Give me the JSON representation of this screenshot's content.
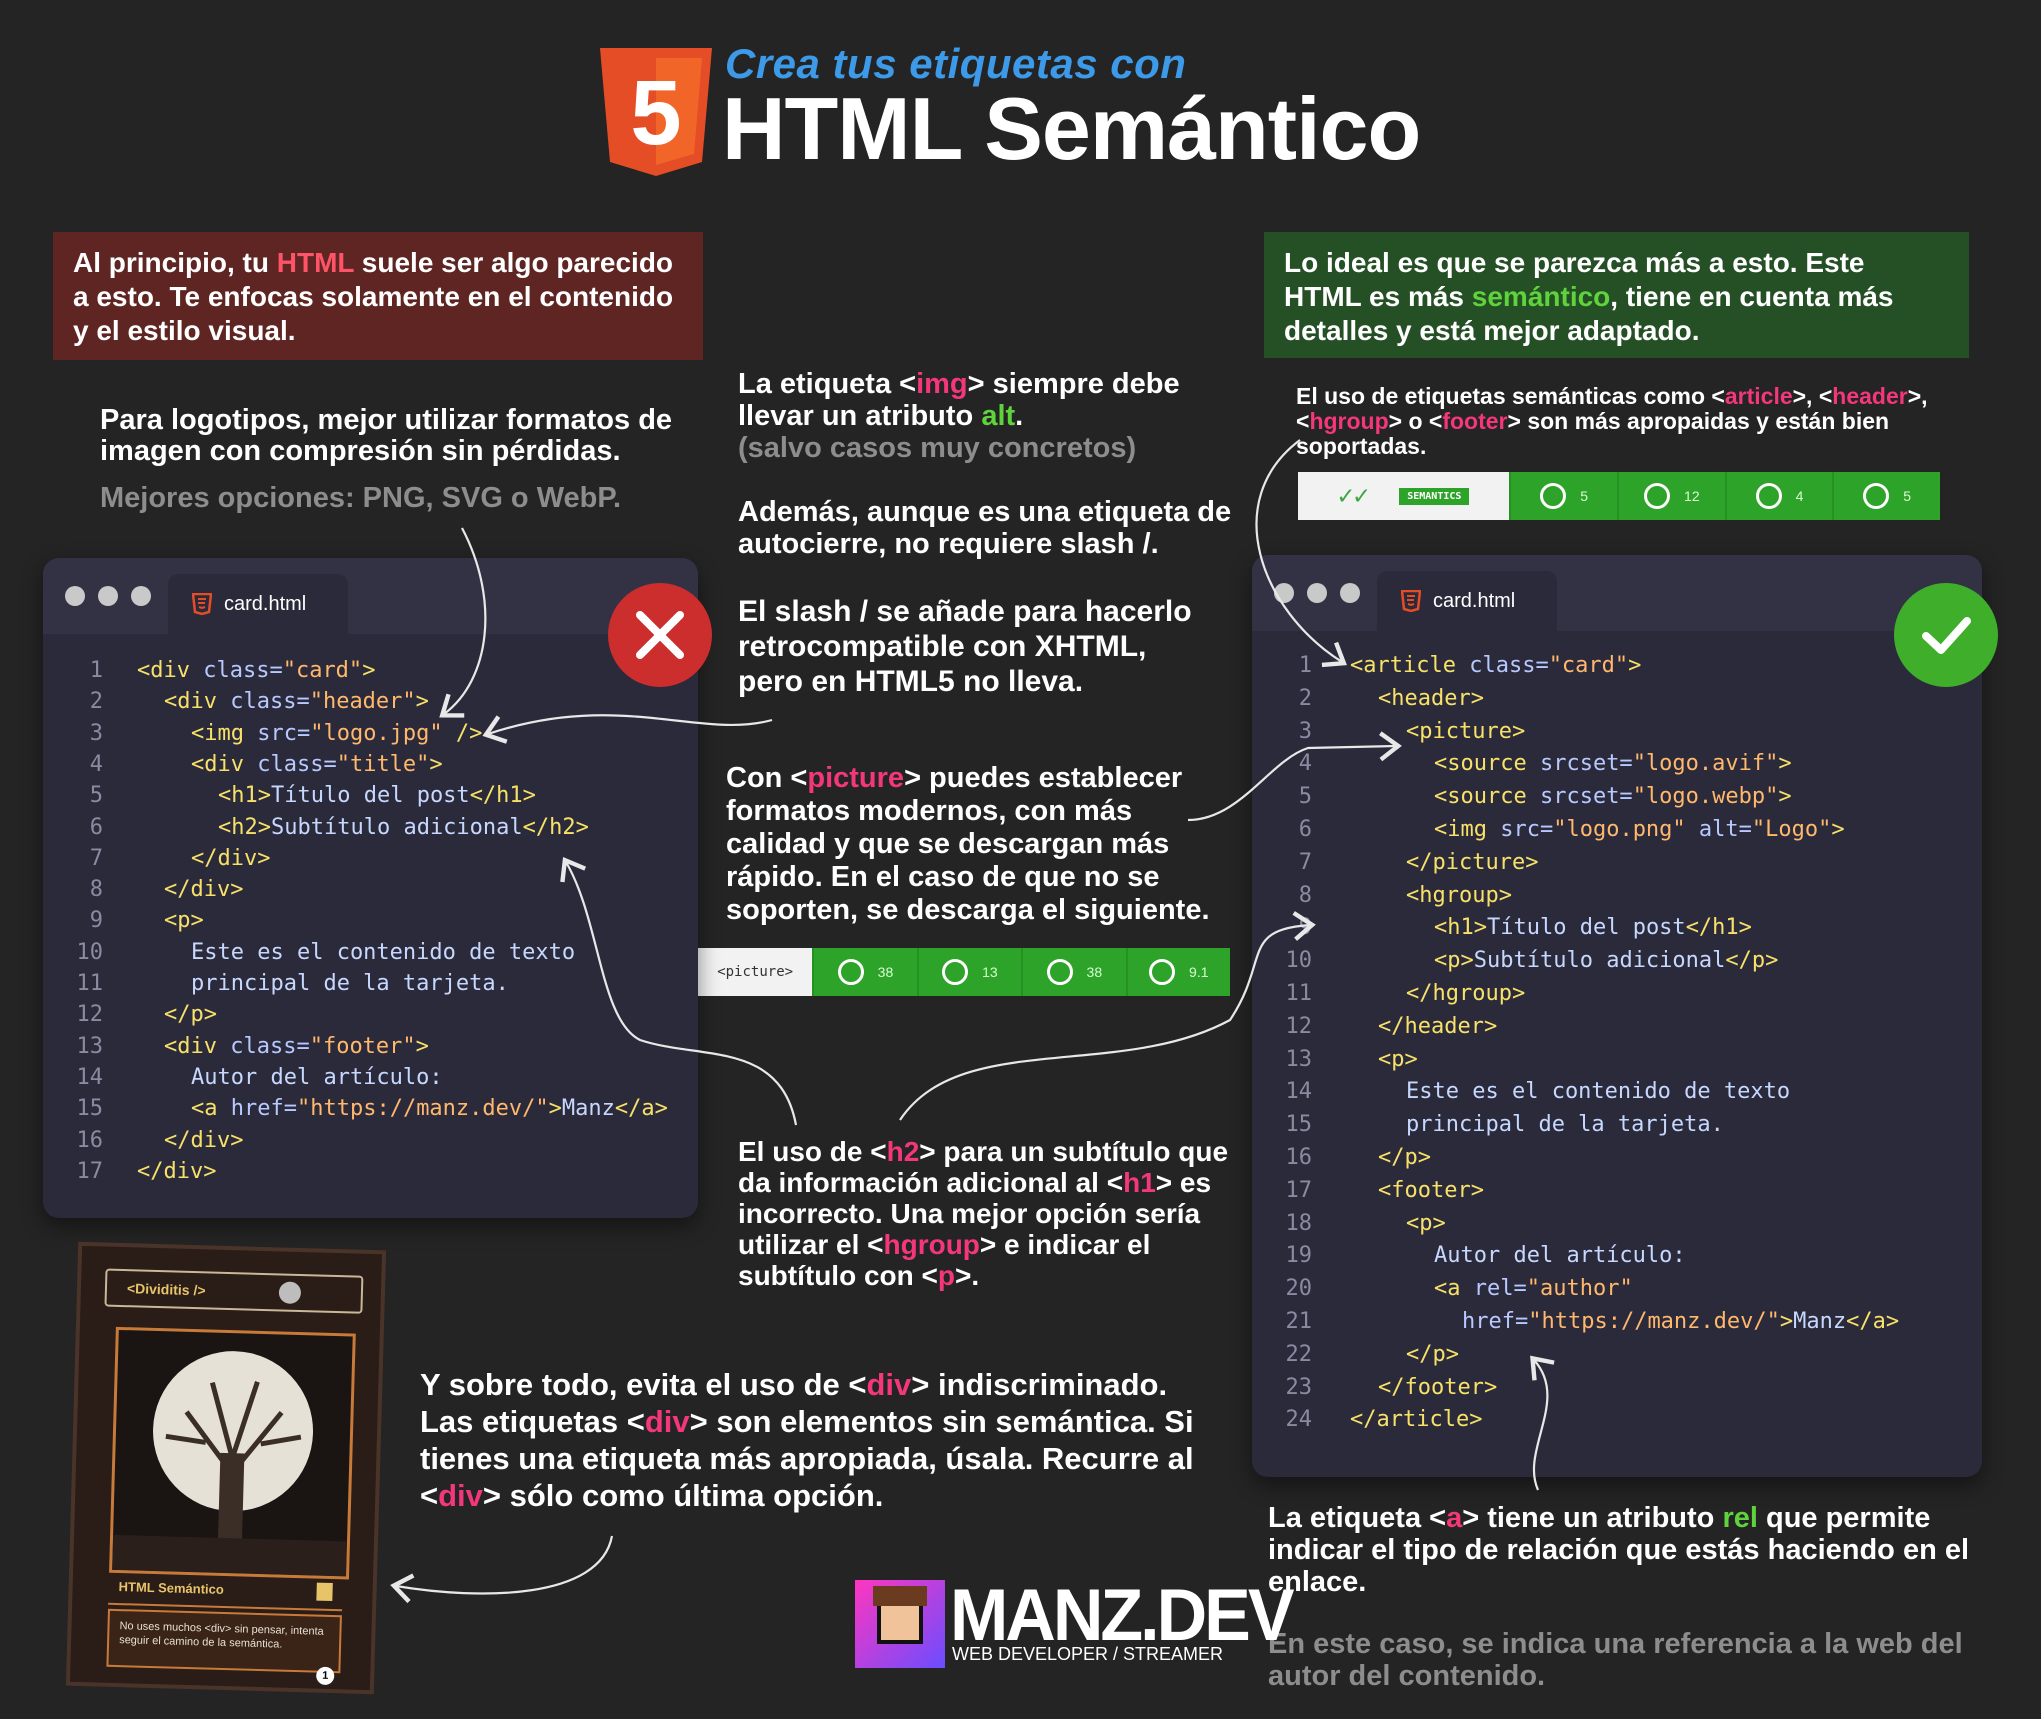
{
  "header": {
    "logo_number": "5",
    "kicker": "Crea tus etiquetas con",
    "title": "HTML Semántico"
  },
  "intro_bad": {
    "pre": "Al principio, tu ",
    "highlight": "HTML",
    "post": " suele ser algo parecido a esto. Te enfocas solamente en el contenido y el estilo visual."
  },
  "intro_good": {
    "pre": "Lo ideal es que se parezca más a esto. Este HTML es más ",
    "highlight": "semántico",
    "post": ", tiene en cuenta más detalles y está mejor adaptado."
  },
  "notes": {
    "logos_main": "Para logotipos, mejor utilizar formatos de imagen con compresión sin pérdidas.",
    "logos_sub": "Mejores opciones: PNG, SVG o WebP.",
    "img_1": "La etiqueta <",
    "img_tag": "img",
    "img_2": "> siempre debe llevar un atributo ",
    "img_attr": "alt",
    "img_3": ".",
    "img_sub": "(salvo casos muy concretos)",
    "slash_main": "Además, aunque es una etiqueta de autocierre, no requiere slash /.",
    "slash_sub": "El slash / se añade para hacerlo retrocompatible con XHTML, pero en HTML5 no lleva.",
    "picture_1": "Con <",
    "picture_tag": "picture",
    "picture_2": "> puedes establecer formatos modernos, con más calidad y que se descargan más rápido. En el caso de que no se soporten, se descarga el siguiente.",
    "h2_1": "El uso de <",
    "h2_tag": "h2",
    "h2_2": "> para un subtítulo que da información adicional al <",
    "h2_tag2": "h1",
    "h2_3": "> es incorrecto. Una mejor opción sería utilizar el <",
    "h2_tag3": "hgroup",
    "h2_4": "> e indicar el subtítulo con <",
    "h2_tag4": "p",
    "h2_5": ">.",
    "div_1": "Y sobre todo, evita el uso de <",
    "div_tag": "div",
    "div_2": "> indiscriminado. Las etiquetas <",
    "div_tag2": "div",
    "div_3": "> son elementos sin semántica. Si tienes una etiqueta más apropiada, úsala. Recurre al <",
    "div_tag3": "div",
    "div_4": "> sólo como última opción.",
    "sem_1": "El uso de etiquetas semánticas como <",
    "sem_t1": "article",
    "sem_2": ">, <",
    "sem_t2": "header",
    "sem_3": ">, <",
    "sem_t3": "hgroup",
    "sem_4": "> o <",
    "sem_t4": "footer",
    "sem_5": "> son más apropaidas y están bien soportadas.",
    "a_1": "La etiqueta <",
    "a_tag": "a",
    "a_2": "> tiene un atributo ",
    "a_attr": "rel",
    "a_3": " que permite indicar el tipo de relación que estás haciendo en el enlace.",
    "a_sub": "En este caso, se indica una referencia a la web del autor del contenido."
  },
  "bad_window": {
    "filename": "card.html",
    "line_numbers": [
      "1",
      "2",
      "3",
      "4",
      "5",
      "6",
      "7",
      "8",
      "9",
      "10",
      "11",
      "12",
      "13",
      "14",
      "15",
      "16",
      "17"
    ]
  },
  "good_window": {
    "filename": "card.html",
    "line_numbers": [
      "1",
      "2",
      "3",
      "4",
      "5",
      "6",
      "7",
      "8",
      "9",
      "10",
      "11",
      "12",
      "13",
      "14",
      "15",
      "16",
      "17",
      "18",
      "19",
      "20",
      "21",
      "22",
      "23",
      "24"
    ]
  },
  "code_tokens": {
    "div": "div",
    "class": "class",
    "card": "\"card\"",
    "header": "\"header\"",
    "img": "img",
    "src": "src",
    "logo_jpg": "\"logo.jpg\"",
    "slash_end": "/>",
    "title": "\"title\"",
    "h1": "h1",
    "h1_text": "Título del post",
    "h2": "h2",
    "h2_text": "Subtítulo adicional",
    "p": "p",
    "p_text1": "Este es el contenido de texto",
    "p_text2": "principal de la tarjeta.",
    "footer": "\"footer\"",
    "author_label": "Autor del artículo:",
    "a": "a",
    "href": "href",
    "url": "\"https://manz.dev/\"",
    "manz": "Manz",
    "article": "article",
    "header_tag": "header",
    "picture": "picture",
    "source": "source",
    "srcset": "srcset",
    "avif": "\"logo.avif\"",
    "webp": "\"logo.webp\"",
    "logo_png": "\"logo.png\"",
    "alt": "alt",
    "logo_alt": "\"Logo\"",
    "hgroup": "hgroup",
    "footer_tag": "footer",
    "rel": "rel",
    "author": "\"author\""
  },
  "compat_picture": {
    "label": "<picture>",
    "values": [
      "38",
      "13",
      "38",
      "9.1"
    ]
  },
  "compat_semantics": {
    "label": "SEMANTICS",
    "values": [
      "5",
      "12",
      "4",
      "5"
    ]
  },
  "game_card": {
    "tag": "<Dividitis />",
    "title": "HTML Semántico",
    "text": "No uses muchos <div> sin pensar, intenta seguir el camino de la semántica.",
    "cost": "1"
  },
  "brand": {
    "name": "MANZ.DEV",
    "tagline": "WEB DEVELOPER / STREAMER"
  },
  "colors": {
    "background": "#242424",
    "bad": "#5e2522",
    "good": "#255026",
    "accent_pink": "#f4367a",
    "accent_green": "#5fd33b",
    "html5": "#e44d26"
  }
}
